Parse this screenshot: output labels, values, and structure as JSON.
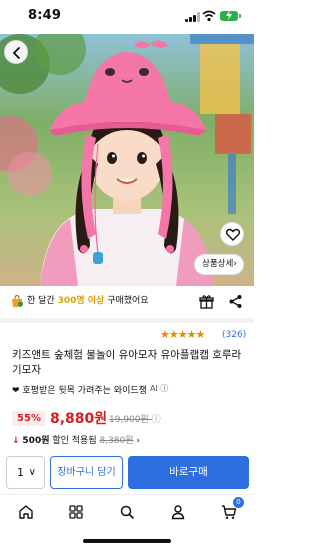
{
  "status_bar": {
    "time": "8:49"
  },
  "hero": {
    "detail_label": "상품상세",
    "detail_chevron": "›",
    "page_dots": 3,
    "active_dot": 1
  },
  "buyers": {
    "prefix": "한 달간 ",
    "count": "300명 이상",
    "suffix": " 구매했어요"
  },
  "rating": {
    "stars": "★★★★★",
    "value": 4.5,
    "reviews": "(326)"
  },
  "product": {
    "title": "키즈앤트 숲체험 물놀이 유아모자 유아플랩캡 호루라기모자",
    "subtitle": "❤ 호평받은 뒷목 가려주는 와이드챙",
    "ai_badge": "AI ⓘ"
  },
  "price": {
    "discount": "55%",
    "sale": "8,880원",
    "original": "19,900원",
    "info_icon": "ⓘ"
  },
  "coupon": {
    "arrow": "↓",
    "amount": "500원",
    "text": " 할인 적용됨 ",
    "strike": "8,380원",
    "chevron": " ›"
  },
  "purchase": {
    "qty": "1",
    "qty_chevron": "∨",
    "cart_label": "장바구니 담기",
    "buy_label": "바로구매"
  },
  "nav": {
    "cart_count": "0"
  },
  "colors": {
    "accent": "#2d6ee0",
    "sale_red": "#d31f1f",
    "star": "#e98800",
    "highlight": "#e0a000"
  }
}
